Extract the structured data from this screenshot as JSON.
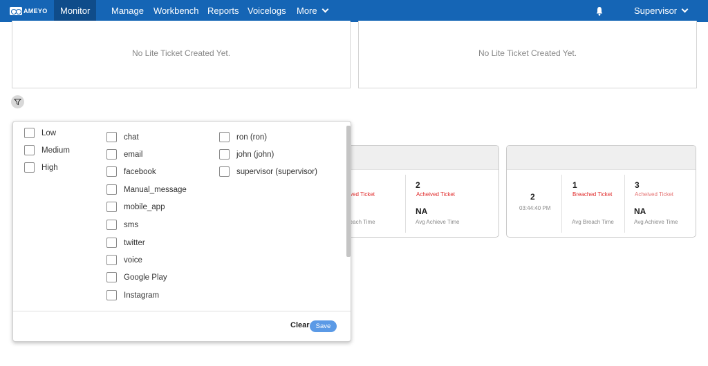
{
  "nav": {
    "logo": "AMEYO",
    "items": [
      "Monitor",
      "Manage",
      "Workbench",
      "Reports",
      "Voicelogs",
      "More"
    ],
    "user": "Supervisor",
    "icons": {
      "logo": "ameyo-logo-icon",
      "bell": "bell-icon",
      "more": "chevron-down-icon",
      "user": "chevron-down-icon"
    }
  },
  "panels": {
    "left_message": "No Lite Ticket Created Yet.",
    "right_message": "No Lite Ticket Created Yet."
  },
  "filter_icon": "filter-icon",
  "card1": {
    "breached_label": "ved Ticket",
    "breach_time_label": "reach Time",
    "achieved_count": "2",
    "achieved_label": "Acheived Ticket",
    "avg_achieve_value": "NA",
    "avg_achieve_label": "Avg Achieve Time"
  },
  "card2": {
    "total": "2",
    "time": "03:44:40 PM",
    "breached_count": "1",
    "breached_label": "Breached Ticket",
    "breach_time_label": "Avg Breach Time",
    "achieved_count": "3",
    "achieved_label": "Acheived Ticket",
    "avg_achieve_value": "NA",
    "avg_achieve_label": "Avg Achieve Time"
  },
  "filter": {
    "priorities": [
      "Low",
      "Medium",
      "High"
    ],
    "channels": [
      "chat",
      "email",
      "facebook",
      "Manual_message",
      "mobile_app",
      "sms",
      "twitter",
      "voice",
      "Google Play",
      "Instagram"
    ],
    "users": [
      "ron (ron)",
      "john (john)",
      "supervisor (supervisor)"
    ],
    "clear_label": "Clear",
    "save_label": "Save"
  },
  "colors": {
    "nav_bg": "#1565b5",
    "nav_active": "#0f4c8a",
    "breached": "#e02a2a",
    "save": "#5b9ae6"
  }
}
